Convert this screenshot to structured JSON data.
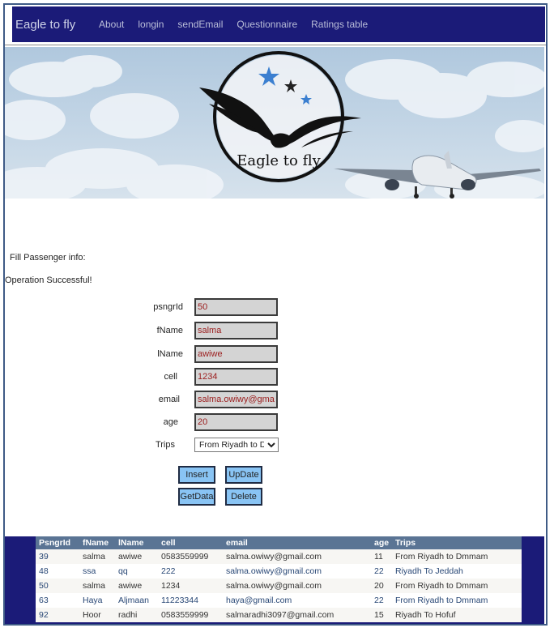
{
  "nav": {
    "brand": "Eagle to fly",
    "links": [
      "About",
      "longin",
      "sendEmail",
      "Questionnaire",
      "Ratings table"
    ]
  },
  "banner": {
    "logo_text": "Eagle to fly"
  },
  "form": {
    "section_label": "Fill Passenger info:",
    "status": "Operation Successful!",
    "fields": [
      {
        "label": "psngrId",
        "value": "50"
      },
      {
        "label": "fName",
        "value": "salma"
      },
      {
        "label": "lName",
        "value": "awiwe"
      },
      {
        "label": "cell",
        "value": "1234"
      },
      {
        "label": "email",
        "value": "salma.owiwy@gmail.com"
      },
      {
        "label": "age",
        "value": "20"
      }
    ],
    "trips_label": "Trips",
    "trips_selected": "From Riyadh to Dmmam",
    "buttons": {
      "insert": "Insert",
      "update": "UpDate",
      "getdata": "GetData",
      "delete": "Delete"
    }
  },
  "table": {
    "headers": [
      "PsngrId",
      "fName",
      "lName",
      "cell",
      "email",
      "age",
      "Trips"
    ],
    "rows": [
      [
        "39",
        "salma",
        "awiwe",
        "0583559999",
        "salma.owiwy@gmail.com",
        "11",
        "From Riyadh to Dmmam"
      ],
      [
        "48",
        "ssa",
        "qq",
        "222",
        "salma.owiwy@gmail.com",
        "22",
        "Riyadh To Jeddah"
      ],
      [
        "50",
        "salma",
        "awiwe",
        "1234",
        "salma.owiwy@gmail.com",
        "20",
        "From Riyadh to Dmmam"
      ],
      [
        "63",
        "Haya",
        "Aljmaan",
        "11223344",
        "haya@gmail.com",
        "22",
        "From Riyadh to Dmmam"
      ],
      [
        "92",
        "Hoor",
        "radhi",
        "0583559999",
        "salmaradhi3097@gmail.com",
        "15",
        "Riyadh To Hofuf"
      ]
    ]
  }
}
